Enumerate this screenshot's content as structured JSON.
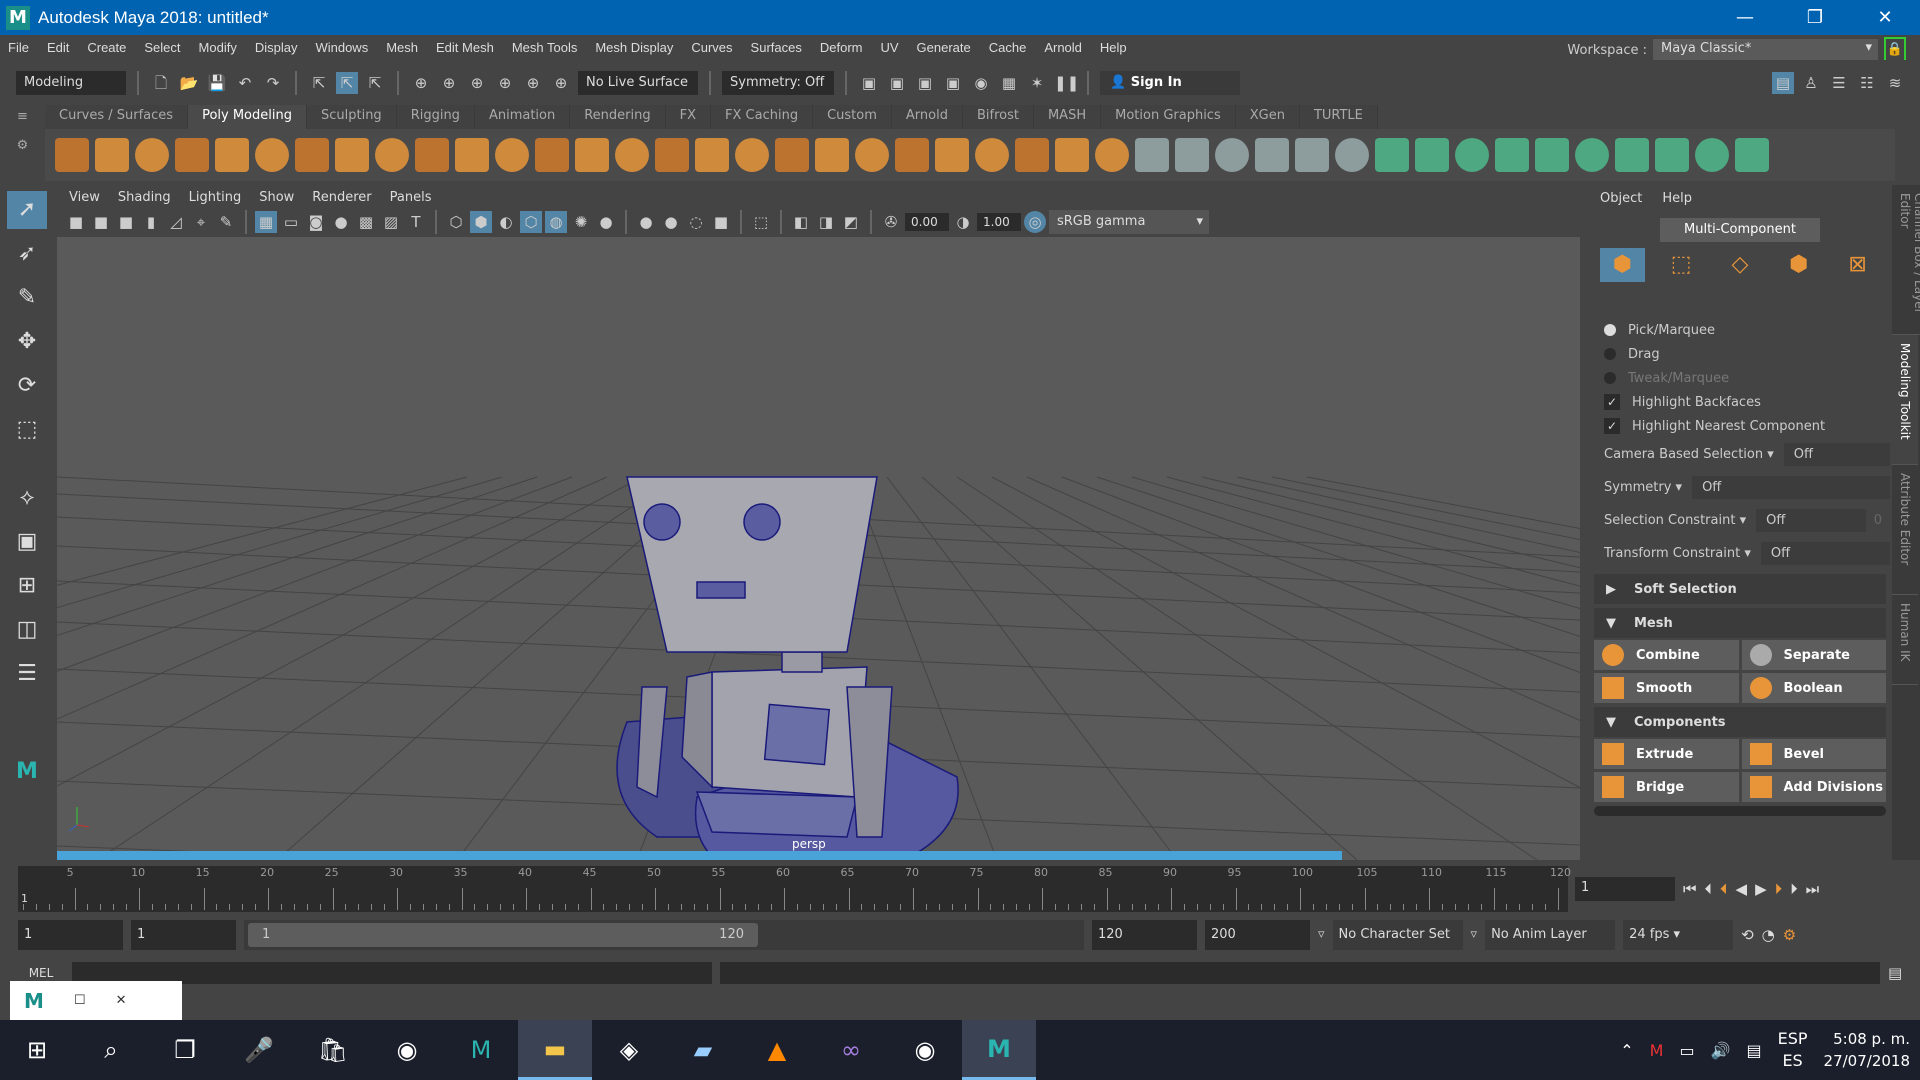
{
  "window": {
    "title": "Autodesk Maya 2018: untitled*",
    "minimize": "—",
    "maximize": "❐",
    "close": "✕"
  },
  "menus": [
    "File",
    "Edit",
    "Create",
    "Select",
    "Modify",
    "Display",
    "Windows",
    "Mesh",
    "Edit Mesh",
    "Mesh Tools",
    "Mesh Display",
    "Curves",
    "Surfaces",
    "Deform",
    "UV",
    "Generate",
    "Cache",
    "Arnold",
    "Help"
  ],
  "workspace": {
    "label": "Workspace :",
    "value": "Maya Classic*"
  },
  "statusline": {
    "mode": "Modeling",
    "live_surface": "No Live Surface",
    "symmetry": "Symmetry: Off",
    "sign_in": "Sign In"
  },
  "shelf_tabs": [
    "Curves / Surfaces",
    "Poly Modeling",
    "Sculpting",
    "Rigging",
    "Animation",
    "Rendering",
    "FX",
    "FX Caching",
    "Custom",
    "Arnold",
    "Bifrost",
    "MASH",
    "Motion Graphics",
    "XGen",
    "TURTLE"
  ],
  "shelf_active": "Poly Modeling",
  "panel_menus": [
    "View",
    "Shading",
    "Lighting",
    "Show",
    "Renderer",
    "Panels"
  ],
  "viewport": {
    "exposure": "0.00",
    "gamma": "1.00",
    "color_space": "sRGB gamma",
    "camera": "persp"
  },
  "modeling_toolkit": {
    "menus": [
      "Object",
      "Help"
    ],
    "multi_component": "Multi-Component",
    "pick_modes": [
      "Pick/Marquee",
      "Drag",
      "Tweak/Marquee"
    ],
    "checks": [
      "Highlight Backfaces",
      "Highlight Nearest Component"
    ],
    "props": [
      {
        "label": "Camera Based Selection",
        "value": "Off"
      },
      {
        "label": "Symmetry",
        "value": "Off"
      },
      {
        "label": "Selection Constraint",
        "value": "Off"
      },
      {
        "label": "Transform Constraint",
        "value": "Off"
      }
    ],
    "constraint_num": "0",
    "soft_selection": "Soft Selection",
    "mesh_section": "Mesh",
    "mesh_buttons": [
      "Combine",
      "Separate",
      "Smooth",
      "Boolean"
    ],
    "components_section": "Components",
    "component_buttons": [
      "Extrude",
      "Bevel",
      "Bridge",
      "Add Divisions"
    ]
  },
  "side_tabs": [
    "Channel Box / Layer Editor",
    "Modeling Toolkit",
    "Attribute Editor",
    "Human IK"
  ],
  "timeline": {
    "start": 1,
    "end": 120,
    "current_frame": "1",
    "labels": [
      5,
      10,
      15,
      20,
      25,
      30,
      35,
      40,
      45,
      50,
      55,
      60,
      65,
      70,
      75,
      80,
      85,
      90,
      95,
      100,
      105,
      110,
      115,
      120
    ]
  },
  "range": {
    "start": "1",
    "anim_start": "1",
    "slider_start": "1",
    "slider_end": "120",
    "anim_end": "120",
    "end": "200",
    "character_set": "No Character Set",
    "anim_layer": "No Anim Layer",
    "fps": "24 fps"
  },
  "mel": {
    "label": "MEL"
  },
  "taskbar": {
    "lang": "ESP",
    "region": "ES",
    "time": "5:08 p. m.",
    "date": "27/07/2018"
  }
}
